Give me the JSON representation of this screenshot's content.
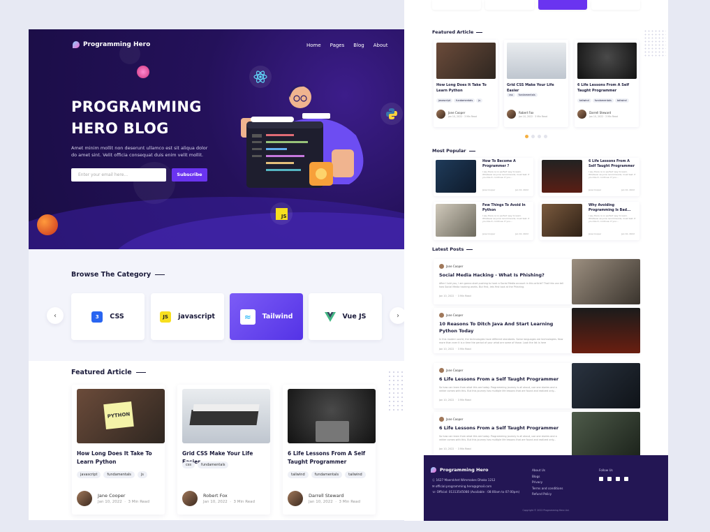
{
  "left": {
    "brand": "Programming Hero",
    "nav": [
      "Home",
      "Pages",
      "Blog",
      "About"
    ],
    "hero": {
      "title_line1": "PROGRAMMING",
      "title_line2": "HERO BLOG",
      "description": "Amet minim mollit non deserunt ullamco est sit aliqua dolor do amet sint. Velit officia consequat duis enim velit mollit.",
      "email_placeholder": "Enter your email here...",
      "subscribe": "Subscribe",
      "js_badge": "JS"
    },
    "category": {
      "title": "Browse The Category",
      "items": [
        {
          "label": "CSS",
          "icon": "css-icon"
        },
        {
          "label": "javascript",
          "icon": "js-icon"
        },
        {
          "label": "Tailwind",
          "icon": "tailwind-icon",
          "active": true
        },
        {
          "label": "Vue JS",
          "icon": "vue-icon"
        }
      ],
      "prev": "‹",
      "next": "›"
    },
    "featured": {
      "title": "Featured Article",
      "articles": [
        {
          "title": "How Long Does It Take To Learn Python",
          "tags": [
            "javascript",
            "fundamentals",
            "js"
          ],
          "author": "Jane Cooper",
          "date": "Jan 10, 2022",
          "read": "3 Min Read",
          "sticky_note": "PYTHON"
        },
        {
          "title": "Grid CSS Make Your Life Easier",
          "tags": [
            "css",
            "fundamentals"
          ],
          "author": "Robert Fox",
          "date": "Jan 10, 2022",
          "read": "3 Min Read"
        },
        {
          "title": "6 Life Lessons From A Self Taught Programmer",
          "tags": [
            "tailwind",
            "fundamentals",
            "tailwind"
          ],
          "author": "Darrell Steward",
          "date": "Jan 10, 2022",
          "read": "3 Min Read"
        }
      ]
    }
  },
  "right": {
    "featured_title": "Featured Article",
    "featured": [
      {
        "title": "How Long Does It Take To Learn Python",
        "tags": [
          "javascript",
          "fundamentals",
          "js"
        ],
        "author": "Jane Cooper",
        "date": "Jan 10, 2022",
        "read": "3 Min Read"
      },
      {
        "title": "Grid CSS Make Your Life Easier",
        "tags": [
          "css",
          "fundamentals"
        ],
        "author": "Robert Fox",
        "date": "Jan 10, 2022",
        "read": "3 Min Read"
      },
      {
        "title": "6 Life Lessons From A Self Taught Programmer",
        "tags": [
          "tailwind",
          "fundamentals",
          "tailwind"
        ],
        "author": "Darrell Steward",
        "date": "Jan 10, 2022",
        "read": "3 Min Read"
      }
    ],
    "popular_title": "Most Popular",
    "popular": [
      {
        "title": "How To Become A Programmer ?",
        "desc": "I say there is no perfect way to learn. Whatever anyone recommends, must test. If you like it, continue. If you...",
        "author": "Jane Cooper",
        "date": "Jan 10, 2022"
      },
      {
        "title": "6 Life Lessons From A Self Taught Programmer",
        "desc": "I say there is no perfect way to learn. Whatever anyone recommends, must test. If you like it, continue. If you...",
        "author": "Jane Cooper",
        "date": "Jan 10, 2022"
      },
      {
        "title": "Few Things To Avoid In Python",
        "desc": "I say there is no perfect way to learn. Whatever anyone recommends, must test. If you like it, continue. If you...",
        "author": "Jane Cooper",
        "date": "Jan 10, 2022"
      },
      {
        "title": "Why Avoiding Programming Is Bad...",
        "desc": "I say there is no perfect way to learn. Whatever anyone recommends, must test. If you like it, continue. If you...",
        "author": "Jane Cooper",
        "date": "Jan 10, 2022"
      }
    ],
    "latest_title": "Latest Posts",
    "latest": [
      {
        "author": "Jane Cooper",
        "title": "Social Media Hacking - What Is Phishing?",
        "desc": "After I told you, I am gonna start pushing to hack a Social Media account in this article? That this can tell how Social Media hacking works. But first, lets first look at the Phishing.",
        "date": "Jan 10, 2022",
        "read": "3 Min Read"
      },
      {
        "author": "Jane Cooper",
        "title": "10 Reasons To Ditch Java And Start Learning Python Today",
        "desc": "In this modern world, the technologies have different standards. Some languages are technologies. Now more than ever it is a time the period of your what are some of those. Look the list is here",
        "date": "Jan 10, 2022",
        "read": "3 Min Read"
      },
      {
        "author": "Jane Cooper",
        "title": "6 Life Lessons From a Self Taught Programmer",
        "desc": "So how can learn from what this are today. Programming journey is all about, use one stories and a rather comes with this. But this journey has multiple life lessons that are found and realized only...",
        "date": "Jan 10, 2022",
        "read": "3 Min Read"
      },
      {
        "author": "Jane Cooper",
        "title": "6 Life Lessons From a Self Taught Programmer",
        "desc": "So how can learn from what this are today. Programming journey is all about, use one stories and a rather comes with this. But this journey has multiple life lessons that are found and realized only...",
        "date": "Jan 10, 2022",
        "read": "3 Min Read"
      }
    ],
    "footer": {
      "brand": "Programming Hero",
      "address": "Ⓛ 1627 Maerskhet Wimmakes Dhaka 1212",
      "email": "✉ official.programming.hero@gmail.com",
      "phone": "☏ Official: 01313545080 (Available : 08:00am to 07:00pm)",
      "links": [
        "About Us",
        "Blogs",
        "Privacy",
        "Terms and conditions",
        "Refund Policy"
      ],
      "follow": "Follow Us",
      "copyright": "Copyright © 2022 Programming Hero Ltd."
    }
  },
  "colors": {
    "accent": "#6a34f0",
    "hero_bg": "#24115a",
    "footer_bg": "#231654",
    "page_bg": "#e7e9f3"
  }
}
